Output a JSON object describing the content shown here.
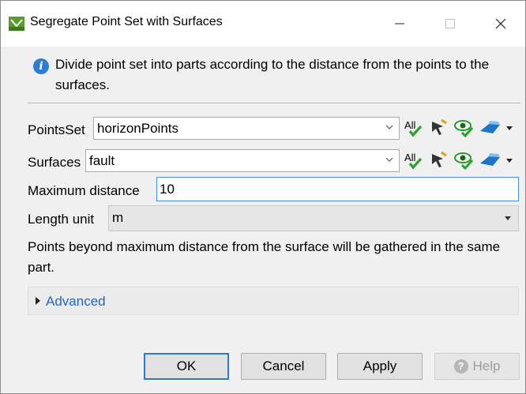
{
  "window": {
    "title": "Segregate Point Set with Surfaces"
  },
  "info": {
    "text": "Divide point set into parts according to the distance from the points to the surfaces."
  },
  "pointsset": {
    "label": "PointsSet",
    "value": "horizonPoints",
    "all_label": "All"
  },
  "surfaces": {
    "label": "Surfaces",
    "value": "fault",
    "all_label": "All"
  },
  "max_distance": {
    "label": "Maximum distance",
    "value": "10"
  },
  "length_unit": {
    "label": "Length unit",
    "value": "m"
  },
  "note": {
    "text": "Points beyond maximum distance from the surface will be gathered in the same part."
  },
  "advanced": {
    "label": "Advanced"
  },
  "buttons": {
    "ok": "OK",
    "cancel": "Cancel",
    "apply": "Apply",
    "help": "Help"
  },
  "colors": {
    "accent": "#2a7ad3",
    "link": "#2365c1",
    "info_icon": "#2e7bd3"
  },
  "icons": [
    "app-icon",
    "minimize-icon",
    "maximize-icon",
    "close-icon",
    "info-icon",
    "chevron-down-icon",
    "select-all-icon",
    "pick-cursor-icon",
    "eye-visibility-icon",
    "view-3d-icon",
    "help-icon"
  ]
}
